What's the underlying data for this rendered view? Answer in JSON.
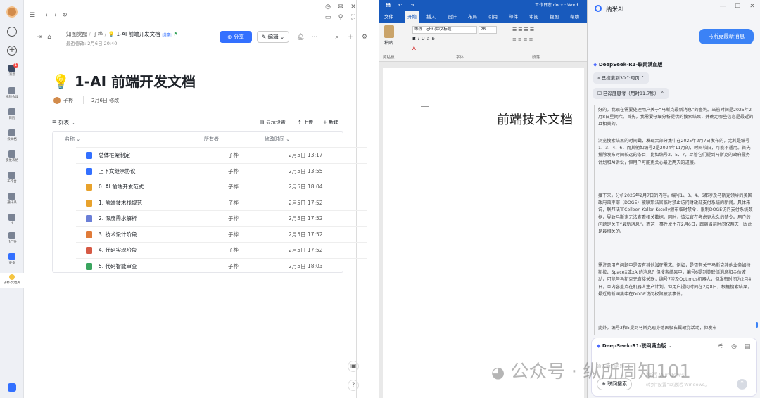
{
  "rail": {
    "items": [
      "消息",
      "视频会议",
      "日历",
      "云文档",
      "多维表格",
      "工作台",
      "通讯录",
      "Hi",
      "飞行任",
      "更多",
      "子桦·文档库"
    ],
    "badge": "1"
  },
  "doc": {
    "breadcrumb": {
      "root": "知图觉醒",
      "parent": "子桦",
      "current": "1-AI 前端开发文档",
      "tag": "分享"
    },
    "last_modified": "最近修改: 2月6日 20:40",
    "share_label": "分享",
    "edit_label": "编辑",
    "title_emoji": "💡",
    "title": "1-AI 前端开发文档",
    "author": "子桦",
    "modified": "2月6日 修改",
    "view_label": "列表",
    "display_settings": "显示设置",
    "upload": "上传",
    "new": "新建",
    "columns": {
      "name": "名称",
      "owner": "所有者",
      "time": "修改时间"
    },
    "rows": [
      {
        "name": "总体框架制定",
        "owner": "子桦",
        "time": "2月5日 13:17",
        "icon_color": "#3370ff"
      },
      {
        "name": "上下文继承协议",
        "owner": "子桦",
        "time": "2月5日 13:55",
        "icon_color": "#3370ff"
      },
      {
        "name": "0. AI 前端开发范式",
        "owner": "子桦",
        "time": "2月5日 18:04",
        "icon_color": "#e8a22c"
      },
      {
        "name": "1. 前端技术栈规范",
        "owner": "子桦",
        "time": "2月5日 17:52",
        "icon_color": "#e8a22c"
      },
      {
        "name": "2. 深度需求解析",
        "owner": "子桦",
        "time": "2月5日 17:52",
        "icon_color": "#6b7fd7"
      },
      {
        "name": "3. 技术设计阶段",
        "owner": "子桦",
        "time": "2月5日 17:52",
        "icon_color": "#e07b39"
      },
      {
        "name": "4. 代码实现阶段",
        "owner": "子桦",
        "time": "2月5日 17:52",
        "icon_color": "#d65a45"
      },
      {
        "name": "5. 代码智能审查",
        "owner": "子桦",
        "time": "2月5日 18:03",
        "icon_color": "#3aa55f"
      }
    ]
  },
  "word": {
    "title": "工作日志.docx · Word",
    "tabs": [
      "文件",
      "开始",
      "插入",
      "设计",
      "布局",
      "引用",
      "邮件",
      "审阅",
      "视图",
      "帮助"
    ],
    "font": "等线 Light (中文标题)",
    "size": "28",
    "groups": {
      "paste": "粘贴",
      "clipboard": "剪贴板",
      "font": "字体",
      "paragraph": "段落"
    },
    "page_text": "前端技术文档"
  },
  "ai": {
    "app_name": "纳米AI",
    "user_message": "马斯克最新消息",
    "model": "DeepSeek-R1-联网满血版",
    "searched": "已搜索到30个网页",
    "thought": "已深度思考（用时91.7秒）",
    "paragraphs": [
      "好的，我现在需要处理用户关于“马斯克最新消息”的查询。当前时间是2025年2月8日星期六。首先，我需要仔细分析提供的搜索结果，并确定哪些信息是最近的且相关的。",
      "浏览搜索结果的时间戳，发现大部分集中在2025年2月7日发布的，尤其是编号1、3、4、6，而其他如编号2是2024年11月的，时间较旧，可能不适用。首先排除发布时间较远的条目，比如编号2、5、7，尽管它们提到马斯克的政府履务计划和AI诉讼，但用户可能更关心最近两天的进展。",
      "接下来，分析2025年2月7日的内容。编号1、3、4、6都涉及马斯克领导的美国政府效率部（DOGE）被联邦法官临时禁止访问财政部支付系统的新闻。具体来说，联邦法官Colleen Kollar-Kotelly颁布临时禁令，限制DOGE访问支付系统数据，导致马斯克无法查看相关数据。同时，该法官在考虑更永久的禁令。用户的问题是关于“最新消息”，而这一事件发生在2月6日，距离当前时间仅两天，因此是最相关的。",
      "需注意用户问题中是否有其他潜在需求。例如，是否有关于马斯克其他业务如特斯拉、SpaceX或xAI的消息？但搜索结果中，编号6提到美联储消息和金价波动，可能与马斯克无直接关联；编号7涉及Optimus机器人，但发布时间为2月4日，且内容重点在机器人生产计划，但用户提问时间在2月8日，根据搜索结果，最近的新闻集中在DOGE访问权限被禁事件。",
      "此外，编号3和5提到马斯克现身德国极右翼政党活动，但发布"
    ],
    "input_placeholder": "输入你的问题...",
    "web_search": "联网搜索",
    "activate": "激活 Windows",
    "activate_sub": "转到“设置”以激活 Windows。"
  },
  "watermark": "公众号 · 纵所周知101"
}
